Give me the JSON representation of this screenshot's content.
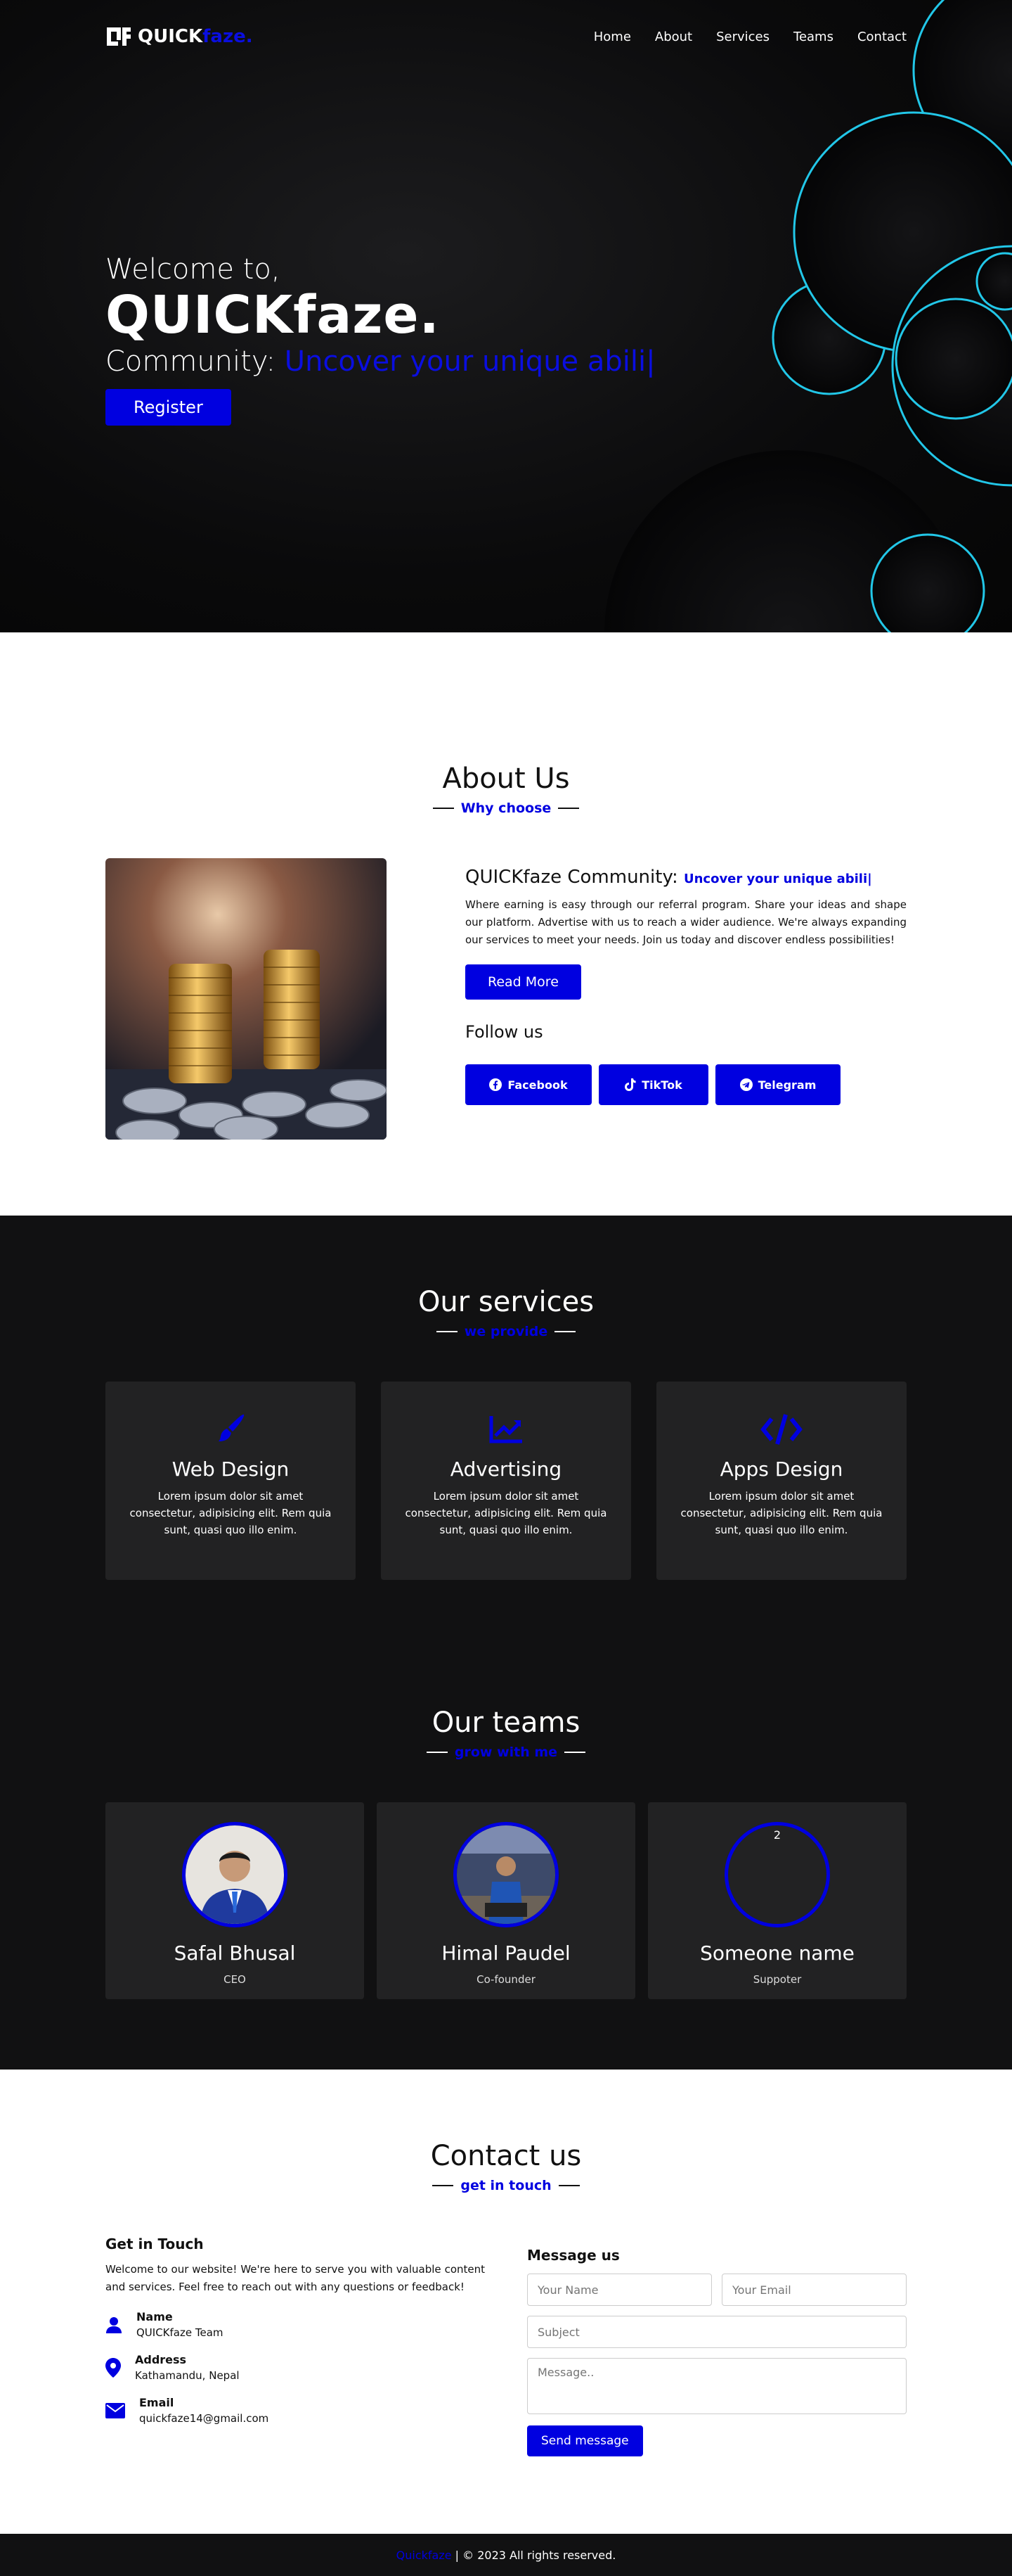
{
  "nav": {
    "logo_part1": "QUICK",
    "logo_part2": "faze.",
    "items": [
      {
        "label": "Home"
      },
      {
        "label": "About"
      },
      {
        "label": "Services"
      },
      {
        "label": "Teams"
      },
      {
        "label": "Contact"
      }
    ]
  },
  "hero": {
    "welcome": "Welcome to,",
    "brand": "QUICKfaze.",
    "community_label": "Community:",
    "typed": "Uncover your unique abili|",
    "register": "Register"
  },
  "about": {
    "title": "About Us",
    "subtitle": "Why choose",
    "heading": "QUICKfaze Community:",
    "typed": "Uncover your unique abili|",
    "paragraph": "Where earning is easy through our referral program. Share your ideas and shape our platform. Advertise with us to reach a wider audience. We're always expanding our services to meet your needs. Join us today and discover endless possibilities!",
    "read_more": "Read More",
    "follow": "Follow us",
    "socials": [
      {
        "label": "Facebook",
        "icon": "facebook-icon"
      },
      {
        "label": "TikTok",
        "icon": "tiktok-icon"
      },
      {
        "label": "Telegram",
        "icon": "telegram-icon"
      }
    ]
  },
  "services": {
    "title": "Our services",
    "subtitle": "we provide",
    "items": [
      {
        "title": "Web Design",
        "icon": "paintbrush-icon",
        "text": "Lorem ipsum dolor sit amet consectetur, adipisicing elit. Rem quia sunt, quasi quo illo enim."
      },
      {
        "title": "Advertising",
        "icon": "chart-line-icon",
        "text": "Lorem ipsum dolor sit amet consectetur, adipisicing elit. Rem quia sunt, quasi quo illo enim."
      },
      {
        "title": "Apps Design",
        "icon": "code-icon",
        "text": "Lorem ipsum dolor sit amet consectetur, adipisicing elit. Rem quia sunt, quasi quo illo enim."
      }
    ]
  },
  "teams": {
    "title": "Our teams",
    "subtitle": "grow with me",
    "members": [
      {
        "name": "Safal Bhusal",
        "role": "CEO"
      },
      {
        "name": "Himal Paudel",
        "role": "Co-founder"
      },
      {
        "name": "Someone name",
        "role": "Suppoter",
        "badge": "2"
      }
    ]
  },
  "contact": {
    "title": "Contact us",
    "subtitle": "get in touch",
    "info_heading": "Get in Touch",
    "info_text": "Welcome to our website! We're here to serve you with valuable content and services. Feel free to reach out with any questions or feedback!",
    "items": [
      {
        "key": "Name",
        "value": "QUICKfaze Team",
        "icon": "user-icon"
      },
      {
        "key": "Address",
        "value": "Kathamandu, Nepal",
        "icon": "map-pin-icon"
      },
      {
        "key": "Email",
        "value": "quickfaze14@gmail.com",
        "icon": "envelope-icon"
      }
    ],
    "form_heading": "Message us",
    "name_placeholder": "Your Name",
    "email_placeholder": "Your Email",
    "subject_placeholder": "Subject",
    "message_placeholder": "Message..",
    "send": "Send message"
  },
  "footer": {
    "brand": "Quickfaze",
    "rights": "| © 2023 All rights reserved."
  },
  "colors": {
    "accent": "#0000e0",
    "dark": "#111112",
    "card": "#222223",
    "bubble": "#22c7e8"
  }
}
